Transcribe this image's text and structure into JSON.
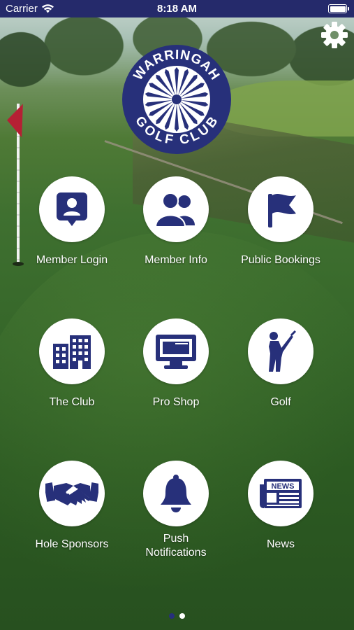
{
  "status_bar": {
    "carrier": "Carrier",
    "time": "8:18 AM"
  },
  "logo": {
    "top_text": "WARRINGAH",
    "bottom_text": "GOLF CLUB"
  },
  "theme": {
    "brand_navy": "#27307a",
    "status_bar": "#252a6b",
    "flag_red": "#b52034",
    "white": "#ffffff"
  },
  "tiles": [
    {
      "label": "Member Login",
      "icon": "member-login-icon"
    },
    {
      "label": "Member Info",
      "icon": "member-info-icon"
    },
    {
      "label": "Public Bookings",
      "icon": "golf-flag-icon"
    },
    {
      "label": "The Club",
      "icon": "building-icon"
    },
    {
      "label": "Pro Shop",
      "icon": "computer-monitor-icon"
    },
    {
      "label": "Golf",
      "icon": "golfer-icon"
    },
    {
      "label": "Hole Sponsors",
      "icon": "handshake-icon"
    },
    {
      "label_line1": "Push",
      "label_line2": "Notifications",
      "icon": "bell-icon"
    },
    {
      "label": "News",
      "icon": "newspaper-icon",
      "icon_text": "NEWS"
    }
  ],
  "pager": {
    "page_count": 2,
    "current_page": 1
  }
}
